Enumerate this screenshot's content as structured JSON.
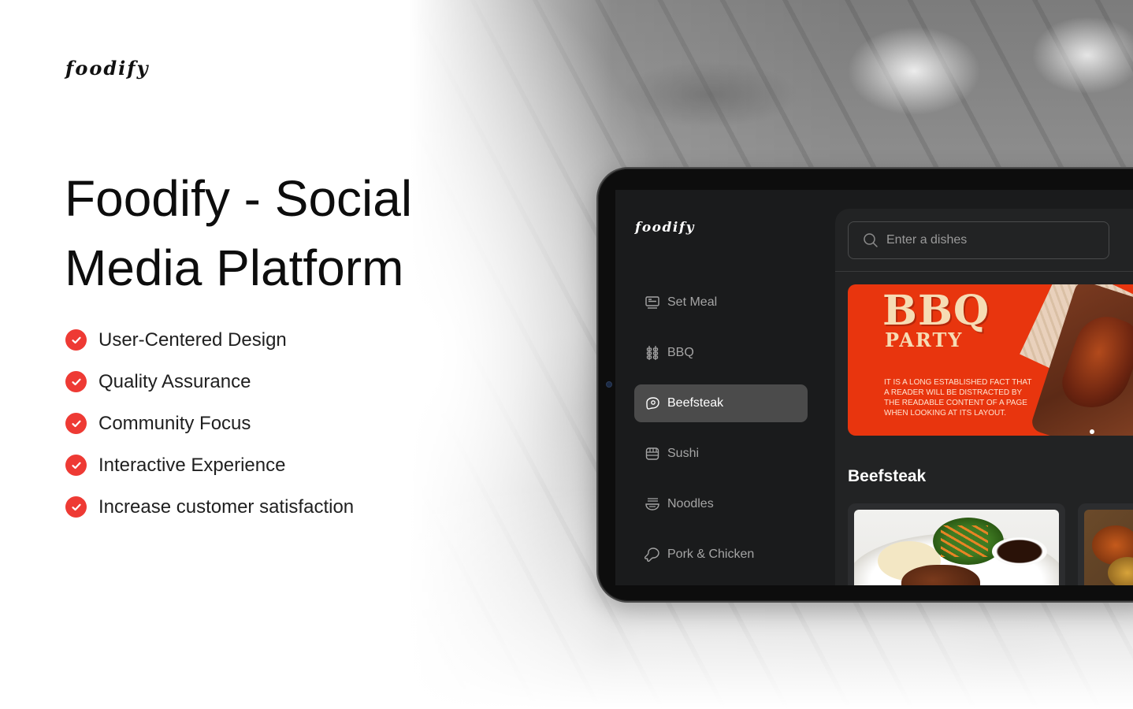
{
  "brand": {
    "name": "foodify"
  },
  "hero": {
    "headline": "Foodify - Social Media Platform",
    "features": [
      "User-Centered Design",
      "Quality Assurance",
      "Community Focus",
      "Interactive Experience",
      "Increase customer satisfaction"
    ],
    "check_color": "#ee3a34"
  },
  "app": {
    "logo": "foodify",
    "nav": [
      {
        "label": "Set Meal",
        "icon": "set-meal-icon",
        "active": false
      },
      {
        "label": "BBQ",
        "icon": "bbq-skewer-icon",
        "active": false
      },
      {
        "label": "Beefsteak",
        "icon": "steak-icon",
        "active": true
      },
      {
        "label": "Sushi",
        "icon": "sushi-icon",
        "active": false
      },
      {
        "label": "Noodles",
        "icon": "noodle-bowl-icon",
        "active": false
      },
      {
        "label": "Pork & Chicken",
        "icon": "drumstick-icon",
        "active": false
      }
    ],
    "search": {
      "placeholder": "Enter a dishes",
      "value": ""
    },
    "banner": {
      "title": "BBQ",
      "subtitle": "PARTY",
      "text": "IT IS A LONG ESTABLISHED FACT THAT A READER WILL BE DISTRACTED BY THE READABLE CONTENT OF A PAGE WHEN LOOKING AT ITS LAYOUT.",
      "color": "#e8350e"
    },
    "section_title": "Beefsteak"
  }
}
